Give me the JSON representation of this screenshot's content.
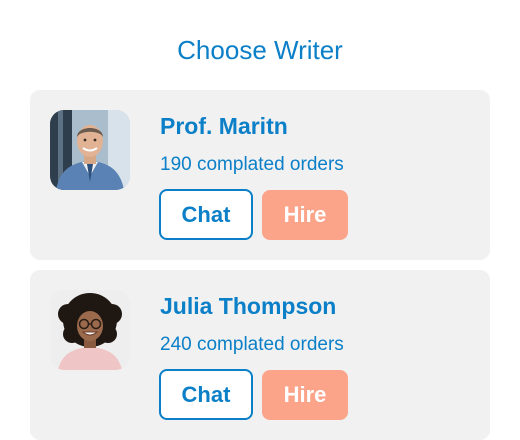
{
  "header": {
    "title": "Choose Writer"
  },
  "writers": [
    {
      "name": "Prof. Maritn",
      "orders": "190 complated orders",
      "chat_label": "Chat",
      "hire_label": "Hire",
      "avatar_icon": "male-professor-portrait"
    },
    {
      "name": "Julia Thompson",
      "orders": "240 complated orders",
      "chat_label": "Chat",
      "hire_label": "Hire",
      "avatar_icon": "female-writer-portrait"
    }
  ],
  "colors": {
    "accent": "#0b7fc7",
    "hire": "#fca48a",
    "card_background": "#f1f1f1"
  }
}
